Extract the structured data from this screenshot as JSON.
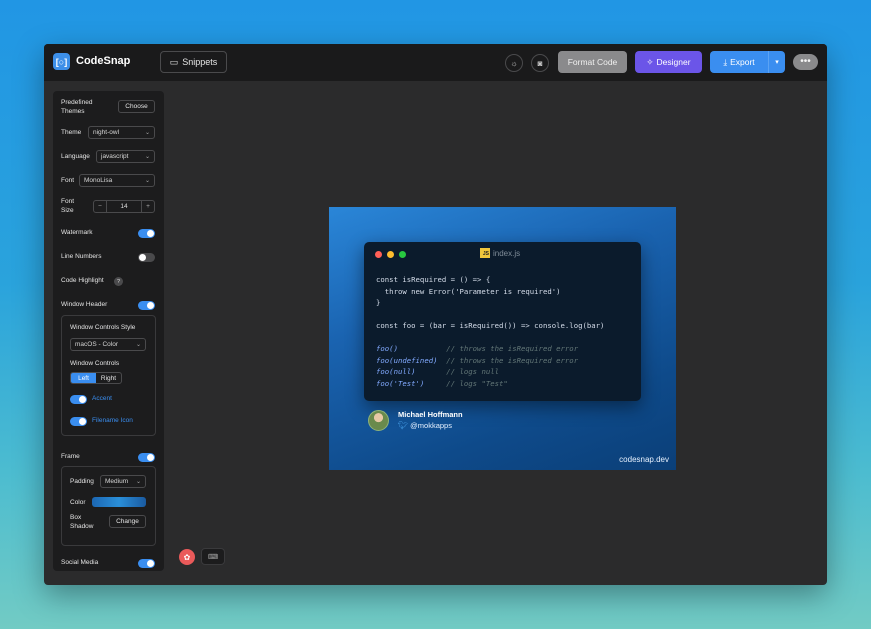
{
  "app": {
    "title": "CodeSnap",
    "snippets_label": "Snippets",
    "format_code_label": "Format Code",
    "designer_label": "Designer",
    "export_label": "Export",
    "more_label": "•••"
  },
  "sidebar": {
    "predefined_themes_label": "Predefined Themes",
    "choose_label": "Choose",
    "theme_label": "Theme",
    "theme_value": "night-owl",
    "language_label": "Language",
    "language_value": "javascript",
    "font_label": "Font",
    "font_value": "MonoLisa",
    "font_size_label": "Font Size",
    "font_size_value": "14",
    "minus": "−",
    "plus": "+",
    "watermark_label": "Watermark",
    "watermark_on": true,
    "line_numbers_label": "Line Numbers",
    "line_numbers_on": false,
    "code_highlight_label": "Code Highlight",
    "help_glyph": "?",
    "window_header_label": "Window Header",
    "window_header_on": true,
    "window_controls_style_label": "Window Controls Style",
    "window_controls_style_value": "macOS - Color",
    "window_controls_label": "Window Controls",
    "left_label": "Left",
    "right_label": "Right",
    "accent_label": "Accent",
    "filename_icon_label": "Filename Icon",
    "frame_label": "Frame",
    "frame_on": true,
    "padding_label": "Padding",
    "padding_value": "Medium",
    "color_label": "Color",
    "box_shadow_label": "Box Shadow",
    "change_label": "Change",
    "social_media_label": "Social Media",
    "social_media_on": true
  },
  "preview": {
    "filename": "index.js",
    "js_badge": "JS",
    "code_lines": [
      "const isRequired = () => {",
      "  throw new Error('Parameter is required')",
      "}",
      "",
      "const foo = (bar = isRequired()) => console.log(bar)",
      "",
      "foo()           // throws the isRequired error",
      "foo(undefined)  // throws the isRequired error",
      "foo(null)       // logs null",
      "foo('Test')     // logs \"Test\""
    ],
    "author_name": "Michael Hoffmann",
    "author_handle": "@mokkapps",
    "watermark": "codesnap.dev"
  },
  "colors": {
    "accent": "#3a8ef0",
    "designer": "#6b55e8",
    "record": "#ea5a5a"
  }
}
